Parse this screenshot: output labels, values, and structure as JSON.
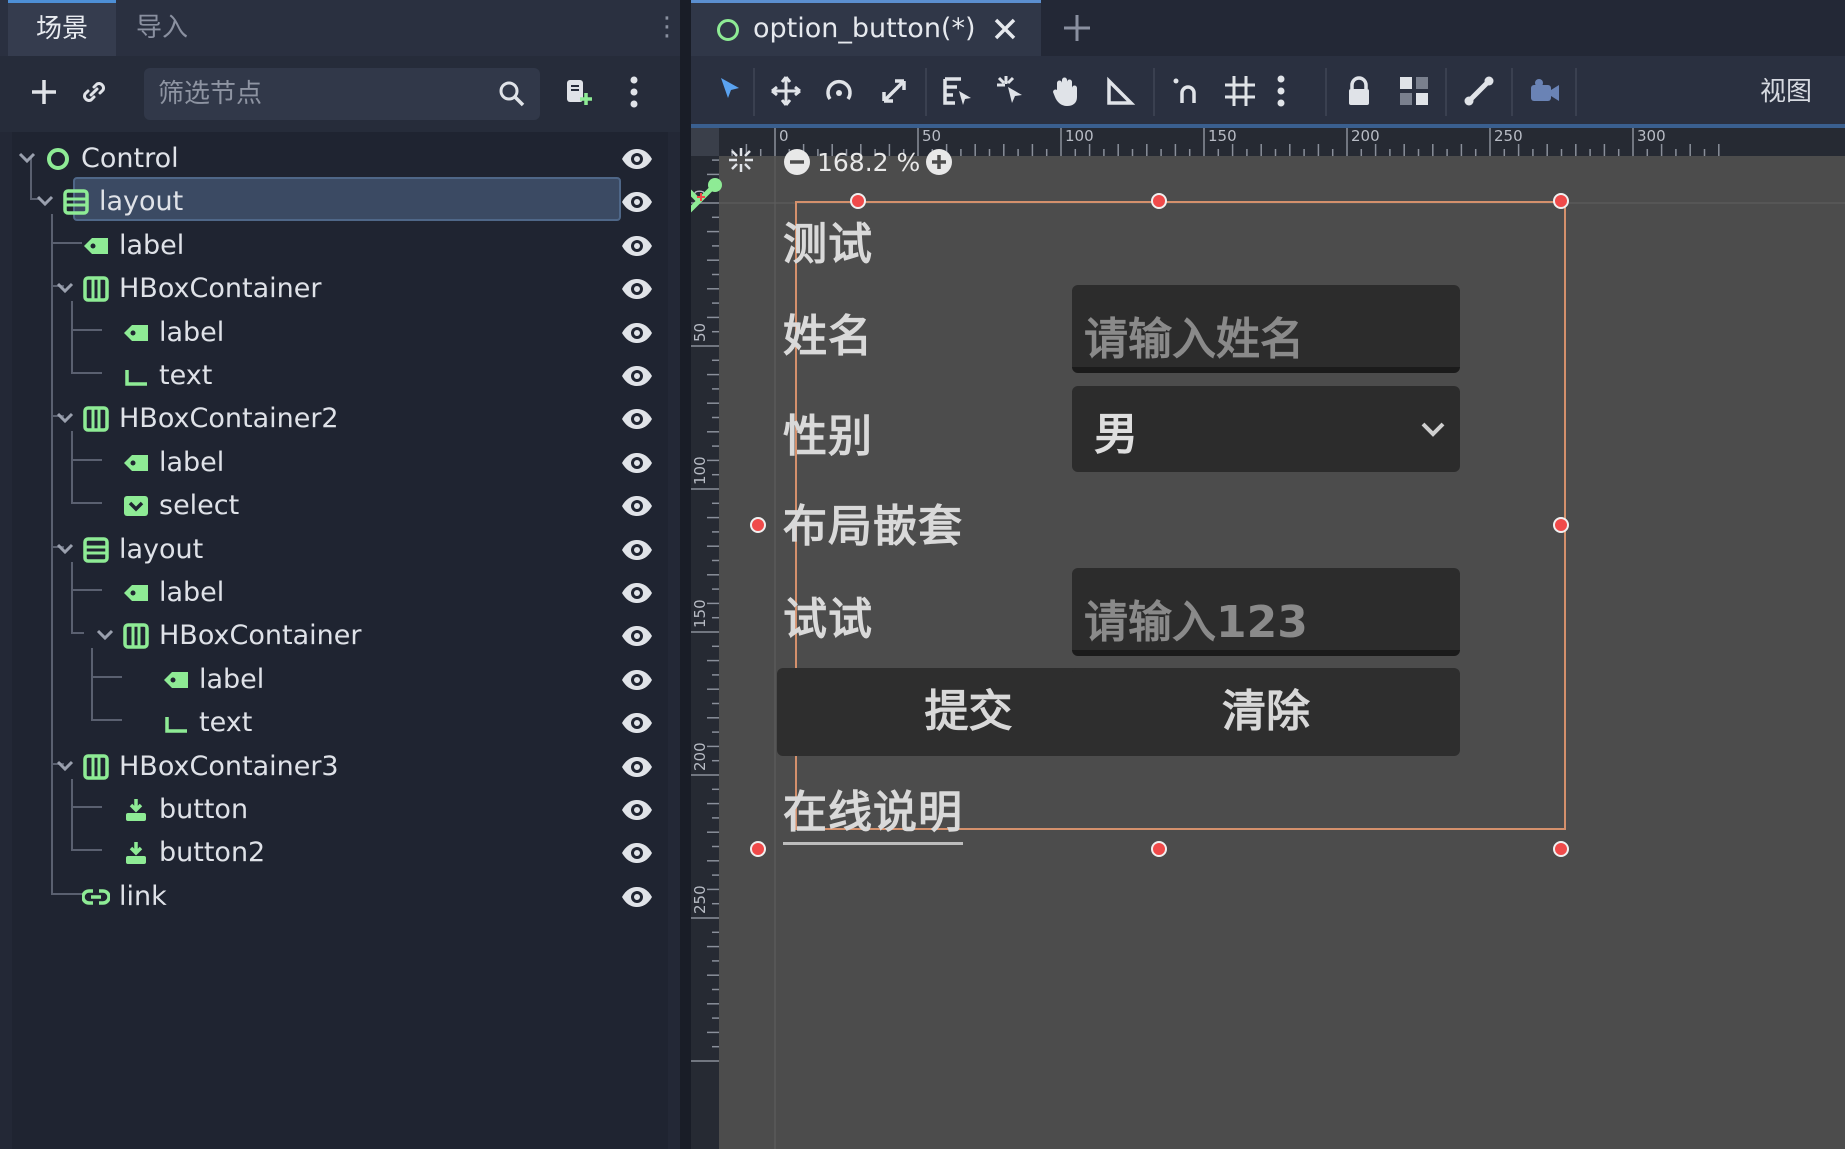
{
  "left_dock": {
    "tabs": [
      "场景",
      "导入"
    ],
    "filter_placeholder": "筛选节点"
  },
  "scene_tree": [
    {
      "label": "Control",
      "icon": "control-circle-icon",
      "level": 0
    },
    {
      "label": "layout",
      "icon": "vbox-icon",
      "level": 1,
      "selected": true
    },
    {
      "label": "label",
      "icon": "label-tag-icon",
      "level": 2
    },
    {
      "label": "HBoxContainer",
      "icon": "hbox-icon",
      "level": 2
    },
    {
      "label": "label",
      "icon": "label-tag-icon",
      "level": 3
    },
    {
      "label": "text",
      "icon": "lineedit-icon",
      "level": 3
    },
    {
      "label": "HBoxContainer2",
      "icon": "hbox-icon",
      "level": 2
    },
    {
      "label": "label",
      "icon": "label-tag-icon",
      "level": 3
    },
    {
      "label": "select",
      "icon": "optionbutton-icon",
      "level": 3
    },
    {
      "label": "layout",
      "icon": "vbox-icon",
      "level": 2
    },
    {
      "label": "label",
      "icon": "label-tag-icon",
      "level": 3
    },
    {
      "label": "HBoxContainer",
      "icon": "hbox-icon",
      "level": 3
    },
    {
      "label": "label",
      "icon": "label-tag-icon",
      "level": 4
    },
    {
      "label": "text",
      "icon": "lineedit-icon",
      "level": 4
    },
    {
      "label": "HBoxContainer3",
      "icon": "hbox-icon",
      "level": 2
    },
    {
      "label": "button",
      "icon": "button-icon",
      "level": 3
    },
    {
      "label": "button2",
      "icon": "button-icon",
      "level": 3
    },
    {
      "label": "link",
      "icon": "linkbutton-icon",
      "level": 2
    }
  ],
  "main_tab": {
    "name": "option_button(*)"
  },
  "toolbar": {
    "view_label": "视图"
  },
  "viewport": {
    "zoom_label": "168.2 %",
    "ruler_top": [
      "0",
      "50",
      "100",
      "150",
      "200",
      "250",
      "300"
    ],
    "ruler_left": [
      "0",
      "50",
      "100",
      "150",
      "200",
      "250"
    ]
  },
  "form": {
    "title": "测试",
    "name_label": "姓名",
    "name_placeholder": "请输入姓名",
    "gender_label": "性别",
    "gender_value": "男",
    "nested_title": "布局嵌套",
    "try_label": "试试",
    "try_placeholder": "请输入123",
    "submit_label": "提交",
    "clear_label": "清除",
    "link_label": "在线说明"
  },
  "colors": {
    "node_green": "#8eeb95",
    "selection_border": "#d4906c",
    "handle_red": "#f04a4a",
    "accent_blue": "#4d8fd6"
  }
}
